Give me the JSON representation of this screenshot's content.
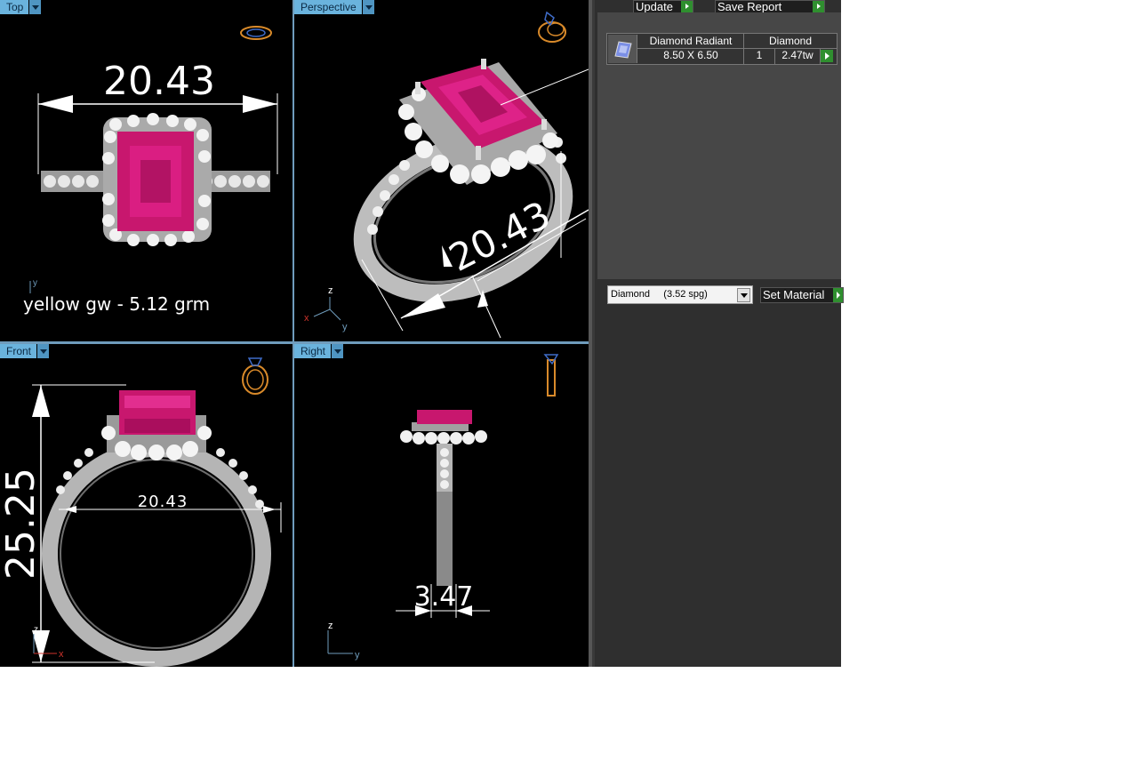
{
  "viewports": {
    "top": {
      "label": "Top"
    },
    "perspective": {
      "label": "Perspective"
    },
    "front": {
      "label": "Front"
    },
    "right": {
      "label": "Right"
    }
  },
  "dimensions": {
    "top_width": "20.43",
    "perspective_width": "20.43",
    "front_width": "20.43",
    "front_height": "25.25",
    "right_width": "3.47"
  },
  "note": "yellow gw - 5.12 grm",
  "axes": {
    "x": "x",
    "y": "y",
    "z": "z"
  },
  "panel": {
    "update_label": "Update",
    "save_report_label": "Save Report",
    "stone_table": {
      "header_shape": "Diamond Radiant",
      "header_material": "Diamond",
      "size": "8.50 X 6.50",
      "count": "1",
      "weight": "2.47tw"
    },
    "material_select_value": "Diamond     (3.52 spg)",
    "set_material_label": "Set Material"
  },
  "colors": {
    "gem": "#c8176e",
    "metal": "#b8b8b8",
    "viewport_tab": "#6ab3dd",
    "panel_bg": "#474747",
    "play_green": "#2f8f2f"
  }
}
